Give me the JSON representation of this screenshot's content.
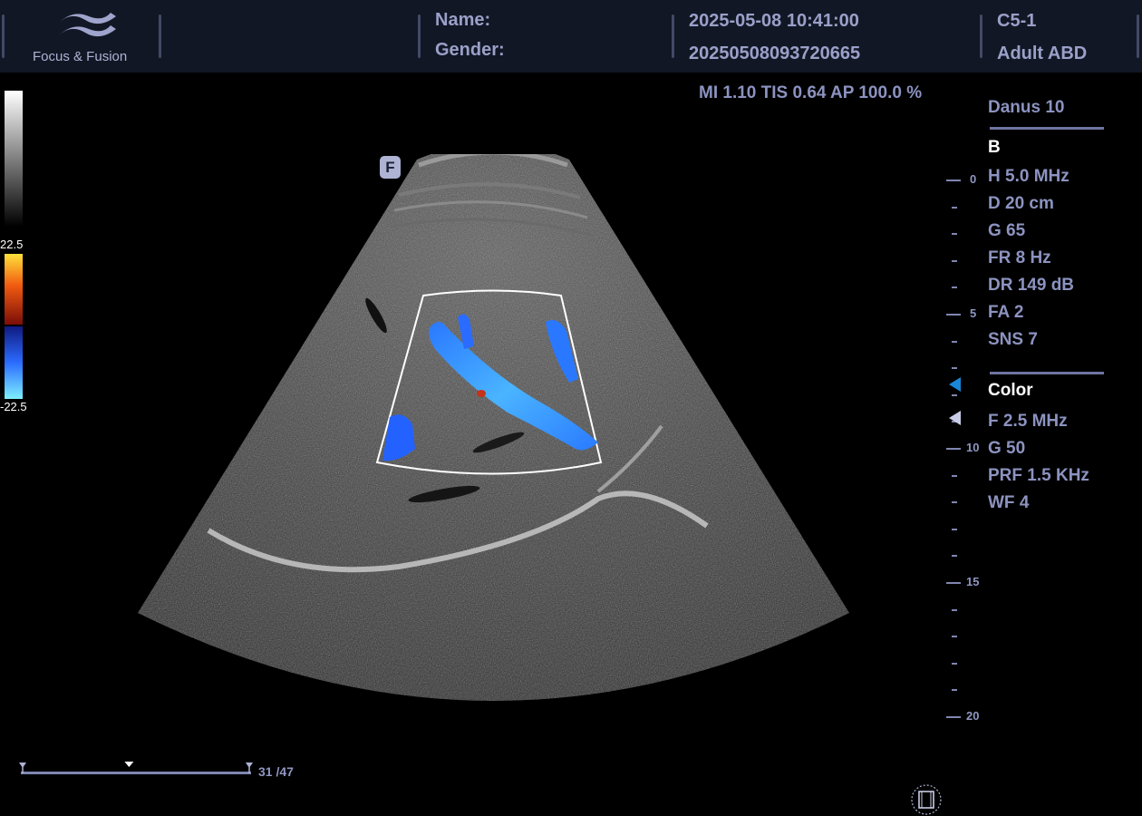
{
  "header": {
    "logo_text": "Focus & Fusion",
    "name_label": "Name:",
    "gender_label": "Gender:",
    "datetime": "2025-05-08  10:41:00",
    "exam_id": "20250508093720665",
    "probe": "C5-1",
    "preset": "Adult ABD"
  },
  "acoustic": "MI 1.10  TIS 0.64  AP 100.0 %",
  "focus_marker": "F",
  "color_scale": {
    "max_label": "22.5",
    "min_label": "-22.5"
  },
  "depth_scale": {
    "labels": [
      "0",
      "5",
      "10",
      "15",
      "20"
    ],
    "unit": "cm"
  },
  "params": {
    "system": "Danus 10",
    "b_mode": {
      "title": "B",
      "items": [
        "H 5.0 MHz",
        "D 20 cm",
        "G 65",
        "FR 8 Hz",
        "DR 149 dB",
        "FA 2",
        "SNS 7"
      ]
    },
    "color_mode": {
      "title": "Color",
      "items": [
        "F 2.5 MHz",
        "G 50",
        "PRF 1.5 KHz",
        "WF 4"
      ]
    }
  },
  "cine": {
    "frame_text": "31 /47",
    "current": 31,
    "total": 47
  },
  "colors": {
    "header_bg": "#121725",
    "text": "#8f96c0",
    "doppler_blue": "#2f8cff",
    "doppler_red": "#c6321a"
  },
  "icons": [
    "logo-wave-icon",
    "film-icon",
    "focus-triangle-icon",
    "marker-triangle-icon"
  ]
}
